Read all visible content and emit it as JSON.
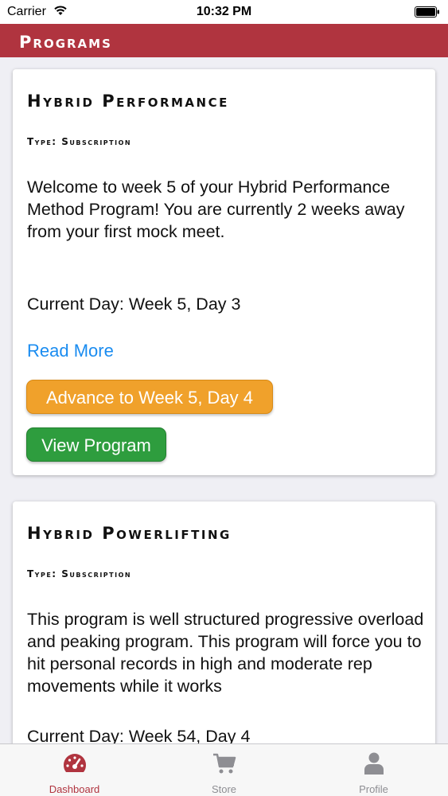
{
  "status_bar": {
    "carrier": "Carrier",
    "time": "10:32 PM"
  },
  "nav": {
    "title": "Programs"
  },
  "programs": [
    {
      "title": "Hybrid Performance",
      "type": "Type: Subscription",
      "description": "Welcome to week 5 of your Hybrid Performance Method Program! You are currently 2 weeks away from your first mock meet.",
      "current_day": "Current Day: Week 5, Day 3",
      "read_more": "Read More",
      "advance_label": "Advance to Week 5, Day 4",
      "view_label": "View Program"
    },
    {
      "title": "Hybrid Powerlifting",
      "type": "Type: Subscription",
      "description": "This program is well structured progressive overload and peaking program. This program will force you to hit personal records in high and moderate rep movements while it works",
      "current_day": "Current Day: Week 54, Day 4"
    }
  ],
  "tabs": [
    {
      "label": "Dashboard",
      "icon": "dashboard-icon"
    },
    {
      "label": "Store",
      "icon": "cart-icon"
    },
    {
      "label": "Profile",
      "icon": "person-icon"
    }
  ],
  "colors": {
    "brand": "#b0343f",
    "advance": "#f0a12b",
    "view": "#2e9d3e",
    "link": "#1a8cf0"
  }
}
